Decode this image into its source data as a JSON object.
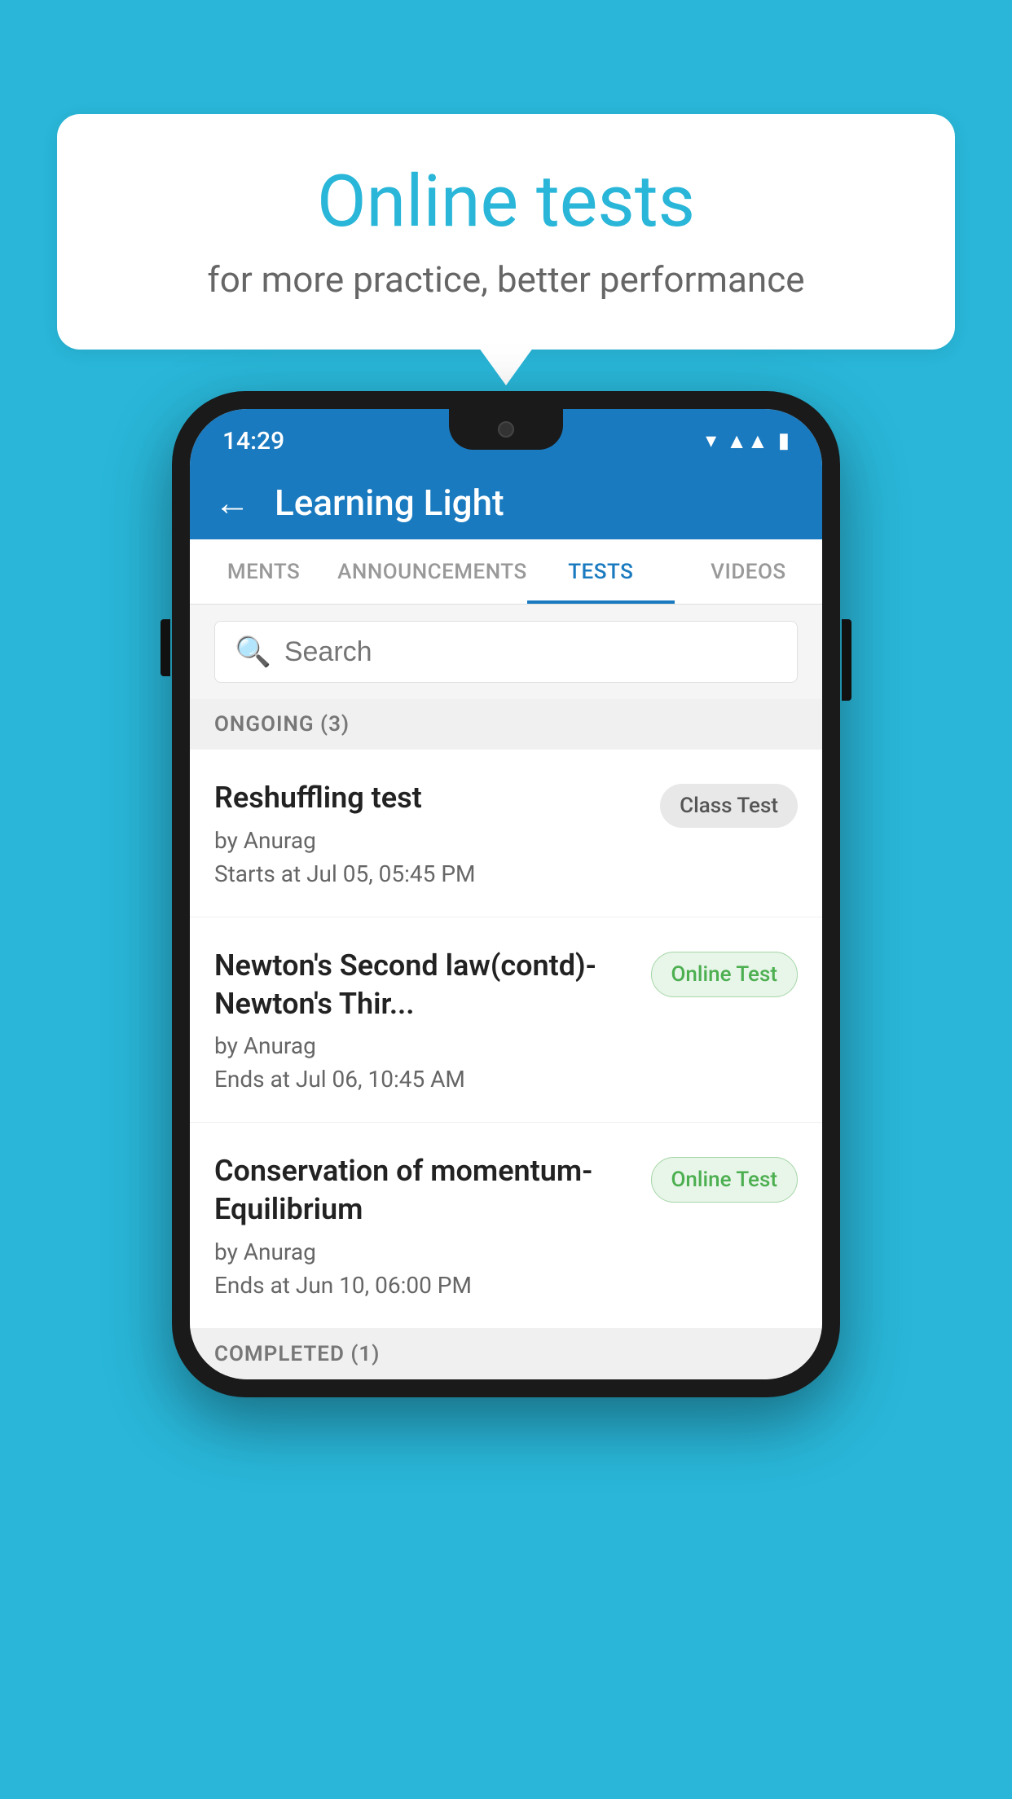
{
  "background_color": "#29b6d8",
  "bubble": {
    "title": "Online tests",
    "subtitle": "for more practice, better performance"
  },
  "status_bar": {
    "time": "14:29",
    "icons": [
      "wifi",
      "signal",
      "battery"
    ]
  },
  "app_header": {
    "title": "Learning Light",
    "back_label": "←"
  },
  "tabs": [
    {
      "label": "MENTS",
      "active": false
    },
    {
      "label": "ANNOUNCEMENTS",
      "active": false
    },
    {
      "label": "TESTS",
      "active": true
    },
    {
      "label": "VIDEOS",
      "active": false
    }
  ],
  "search": {
    "placeholder": "Search"
  },
  "sections": [
    {
      "header": "ONGOING (3)",
      "items": [
        {
          "name": "Reshuffling test",
          "author": "by Anurag",
          "time": "Starts at  Jul 05, 05:45 PM",
          "badge": "Class Test",
          "badge_type": "class"
        },
        {
          "name": "Newton's Second law(contd)-Newton's Thir...",
          "author": "by Anurag",
          "time": "Ends at  Jul 06, 10:45 AM",
          "badge": "Online Test",
          "badge_type": "online"
        },
        {
          "name": "Conservation of momentum-Equilibrium",
          "author": "by Anurag",
          "time": "Ends at  Jun 10, 06:00 PM",
          "badge": "Online Test",
          "badge_type": "online"
        }
      ]
    },
    {
      "header": "COMPLETED (1)",
      "items": []
    }
  ]
}
